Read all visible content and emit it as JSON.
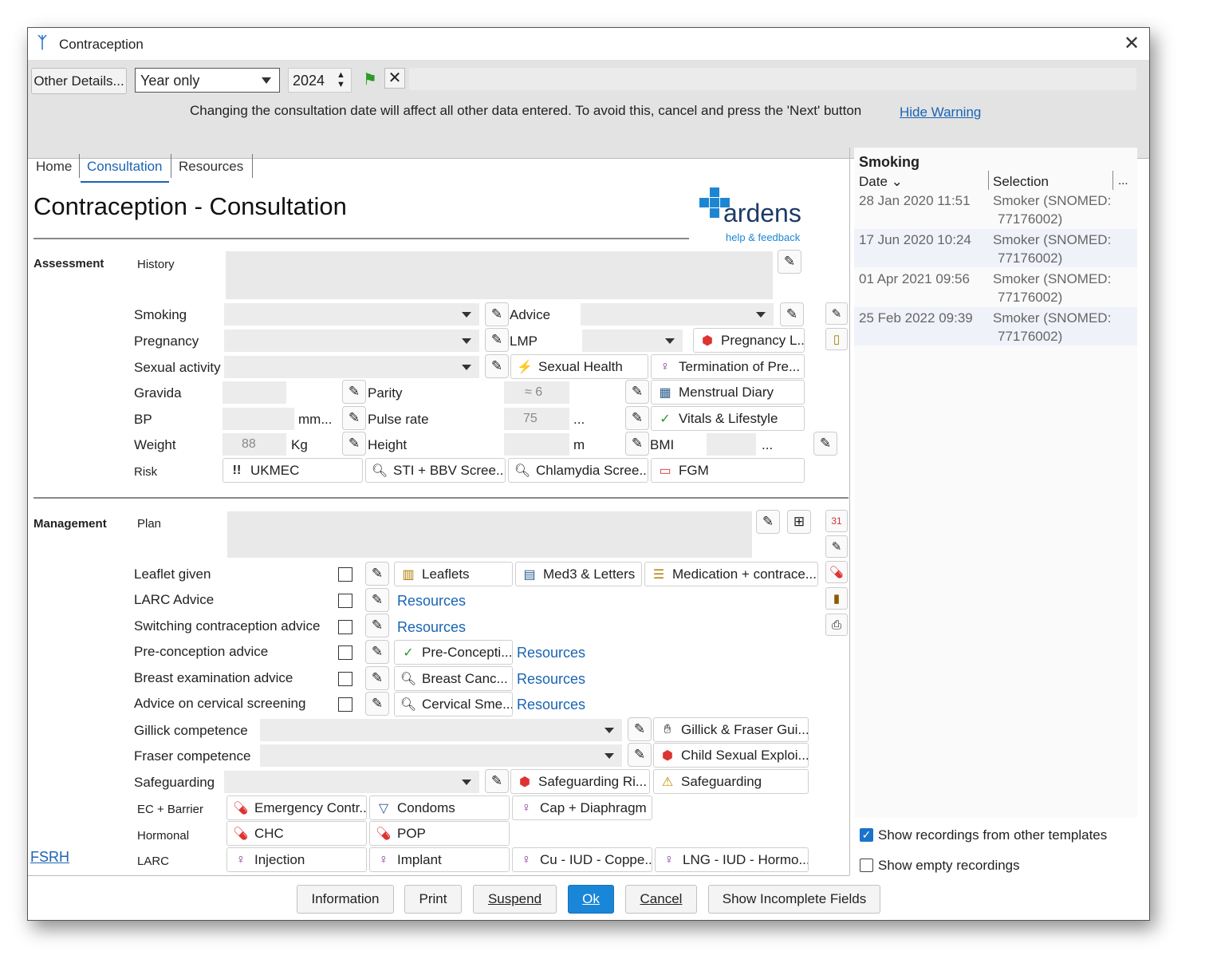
{
  "window": {
    "title": "Contraception"
  },
  "toolbar": {
    "other_details": "Other Details...",
    "date_mode": "Year only",
    "year": "2024",
    "warning": "Changing the consultation date will affect all other data entered. To avoid this, cancel and press the 'Next' button",
    "hide_warning": "Hide Warning"
  },
  "tabs": [
    "Home",
    "Consultation",
    "Resources"
  ],
  "page": {
    "title": "Contraception - Consultation",
    "logo": "ardens",
    "logo_sub": "help & feedback"
  },
  "assessment": {
    "section": "Assessment",
    "history": "History",
    "smoking": "Smoking",
    "advice": "Advice",
    "pregnancy": "Pregnancy",
    "lmp": "LMP",
    "pregnancy_btn": "Pregnancy L...",
    "sexual_activity": "Sexual activity",
    "sexual_health_btn": "Sexual Health",
    "termination_btn": "Termination of Pre...",
    "gravida": "Gravida",
    "parity": "Parity",
    "parity_val": "≈ 6",
    "menstrual_btn": "Menstrual Diary",
    "bp": "BP",
    "bp_unit": "mm...",
    "pulse": "Pulse rate",
    "pulse_val": "75",
    "pulse_unit": "...",
    "vitals_btn": "Vitals & Lifestyle",
    "weight": "Weight",
    "weight_val": "88",
    "weight_unit": "Kg",
    "height": "Height",
    "height_unit": "m",
    "bmi": "BMI",
    "bmi_unit": "...",
    "risk": "Risk",
    "ukmec": "UKMEC",
    "sti": "STI + BBV Scree...",
    "chlamydia": "Chlamydia Scree...",
    "fgm": "FGM"
  },
  "management": {
    "section": "Management",
    "plan": "Plan",
    "rows": [
      {
        "label": "Leaflet given"
      },
      {
        "label": "LARC Advice",
        "link": "Resources"
      },
      {
        "label": "Switching contraception advice",
        "link": "Resources"
      },
      {
        "label": "Pre-conception advice",
        "btn": "Pre-Concepti...",
        "link": "Resources"
      },
      {
        "label": "Breast examination advice",
        "btn": "Breast Canc...",
        "link": "Resources"
      },
      {
        "label": "Advice on cervical screening",
        "btn": "Cervical Sme...",
        "link": "Resources"
      }
    ],
    "leaflets": "Leaflets",
    "med3": "Med3 & Letters",
    "medication": "Medication + contrace...",
    "gillick": "Gillick competence",
    "gillick_btn": "Gillick & Fraser Gui...",
    "fraser": "Fraser competence",
    "cse_btn": "Child Sexual Exploi...",
    "safeguarding": "Safeguarding",
    "safeguarding_risk_btn": "Safeguarding Ri...",
    "safeguarding_btn": "Safeguarding",
    "ec": "EC + Barrier",
    "ec_btn": "Emergency Contr...",
    "condoms": "Condoms",
    "cap": "Cap + Diaphragm",
    "hormonal": "Hormonal",
    "chc": "CHC",
    "pop": "POP",
    "larc": "LARC",
    "injection": "Injection",
    "implant": "Implant",
    "cu_iud": "Cu - IUD - Coppe...",
    "lng_iud": "LNG - IUD - Hormo...",
    "fsrh": "FSRH"
  },
  "side": {
    "title": "Smoking",
    "col_date": "Date",
    "col_sel": "Selection",
    "col_more": "...",
    "rows": [
      {
        "date": "28 Jan 2020 11:51",
        "sel1": "Smoker (SNOMED:",
        "sel2": "77176002)"
      },
      {
        "date": "17 Jun 2020 10:24",
        "sel1": "Smoker (SNOMED:",
        "sel2": "77176002)"
      },
      {
        "date": "01 Apr 2021 09:56",
        "sel1": "Smoker (SNOMED:",
        "sel2": "77176002)"
      },
      {
        "date": "25 Feb 2022 09:39",
        "sel1": "Smoker (SNOMED:",
        "sel2": "77176002)"
      }
    ],
    "show_other": "Show recordings from other templates",
    "show_empty": "Show empty recordings"
  },
  "footer": {
    "information": "Information",
    "print": "Print",
    "suspend": "Suspend",
    "ok": "Ok",
    "cancel": "Cancel",
    "incomplete": "Show Incomplete Fields"
  }
}
